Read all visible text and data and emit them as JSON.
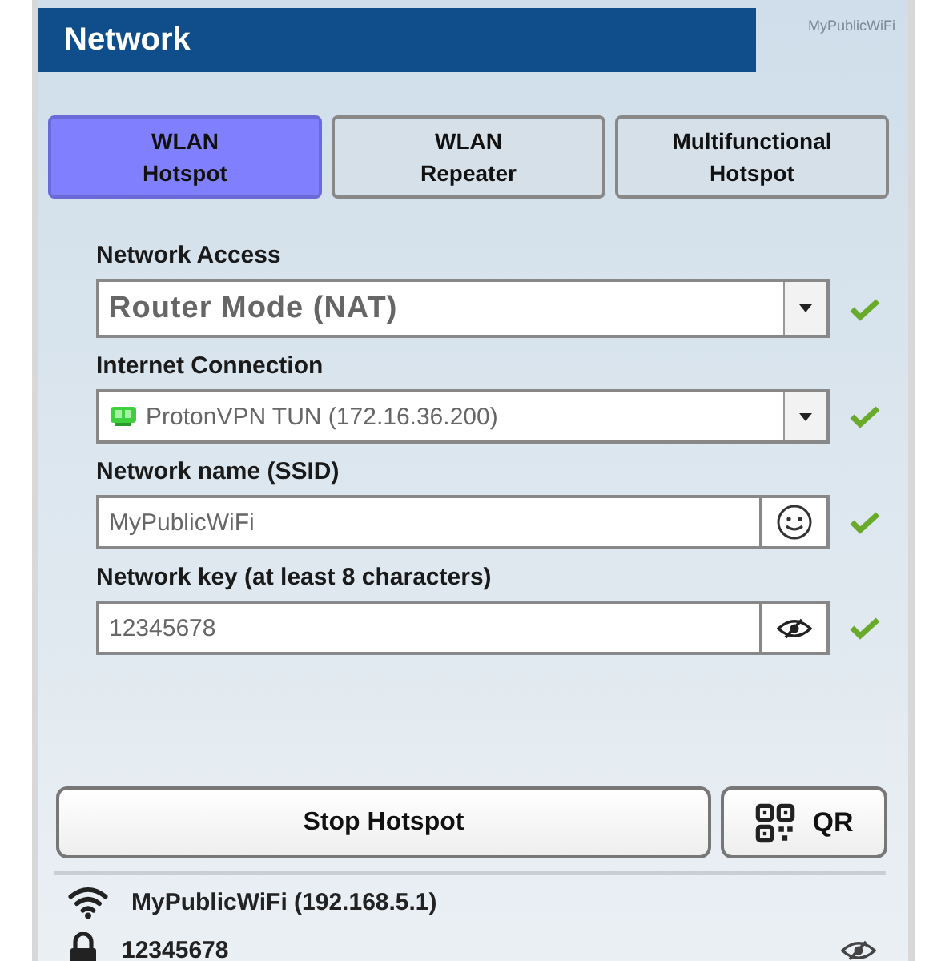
{
  "header": {
    "title": "Network",
    "brand": "MyPublicWiFi"
  },
  "tabs": [
    {
      "lines": [
        "WLAN",
        "Hotspot"
      ],
      "selected": true
    },
    {
      "lines": [
        "WLAN",
        "Repeater"
      ],
      "selected": false
    },
    {
      "lines": [
        "Multifunctional",
        "Hotspot"
      ],
      "selected": false
    }
  ],
  "fields": [
    {
      "kind": "mode-select",
      "label": "Network Access",
      "value": "Router Mode (NAT)",
      "valid": true
    },
    {
      "kind": "adapter-select",
      "label": "Internet Connection",
      "value": "ProtonVPN TUN (172.16.36.200)",
      "valid": true
    },
    {
      "kind": "name-input",
      "label": "Network name (SSID)",
      "value": "MyPublicWiFi",
      "valid": true
    },
    {
      "kind": "key-input",
      "label": "Network key (at least 8 characters)",
      "value": "12345678",
      "valid": true
    }
  ],
  "actions": {
    "primary": "Stop Hotspot",
    "qr": "QR"
  },
  "status": [
    {
      "kind": "wifi",
      "text": "MyPublicWiFi (192.168.5.1)"
    },
    {
      "kind": "key",
      "text": "12345678"
    }
  ]
}
